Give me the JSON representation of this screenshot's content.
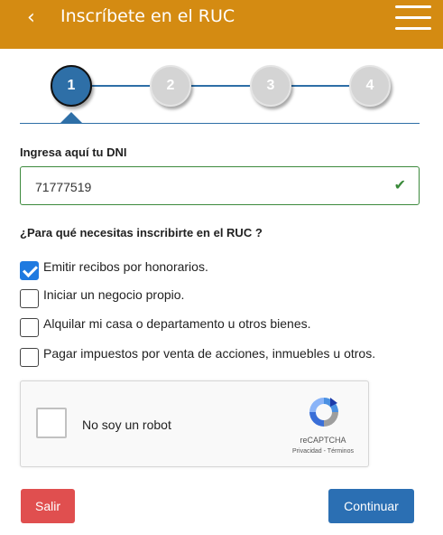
{
  "header": {
    "back_icon": "‹",
    "title": "Inscríbete en el RUC",
    "menu_icon": "hamburger-menu-icon"
  },
  "stepper": {
    "steps": [
      {
        "label": "1",
        "state": "active"
      },
      {
        "label": "2",
        "state": "inactive"
      },
      {
        "label": "3",
        "state": "inactive"
      },
      {
        "label": "4",
        "state": "inactive"
      }
    ]
  },
  "dni": {
    "label": "Ingresa aquí tu DNI",
    "value": "71777519",
    "valid_icon": "✔"
  },
  "purpose": {
    "question": "¿Para qué necesitas inscribirte en el RUC ?",
    "options": [
      {
        "label": "Emitir recibos por honorarios.",
        "checked": true
      },
      {
        "label": "Iniciar un negocio propio.",
        "checked": false
      },
      {
        "label": "Alquilar mi casa o departamento u otros bienes.",
        "checked": false
      },
      {
        "label": "Pagar impuestos por venta de acciones, inmuebles u otros.",
        "checked": false
      }
    ]
  },
  "captcha": {
    "label": "No soy un robot",
    "brand": "reCAPTCHA",
    "links": "Privacidad - Términos"
  },
  "actions": {
    "exit_label": "Salir",
    "continue_label": "Continuar"
  },
  "colors": {
    "header_bg": "#d48b12",
    "primary": "#2e6fa7",
    "danger": "#e04f4f",
    "success": "#3a8a3a"
  }
}
